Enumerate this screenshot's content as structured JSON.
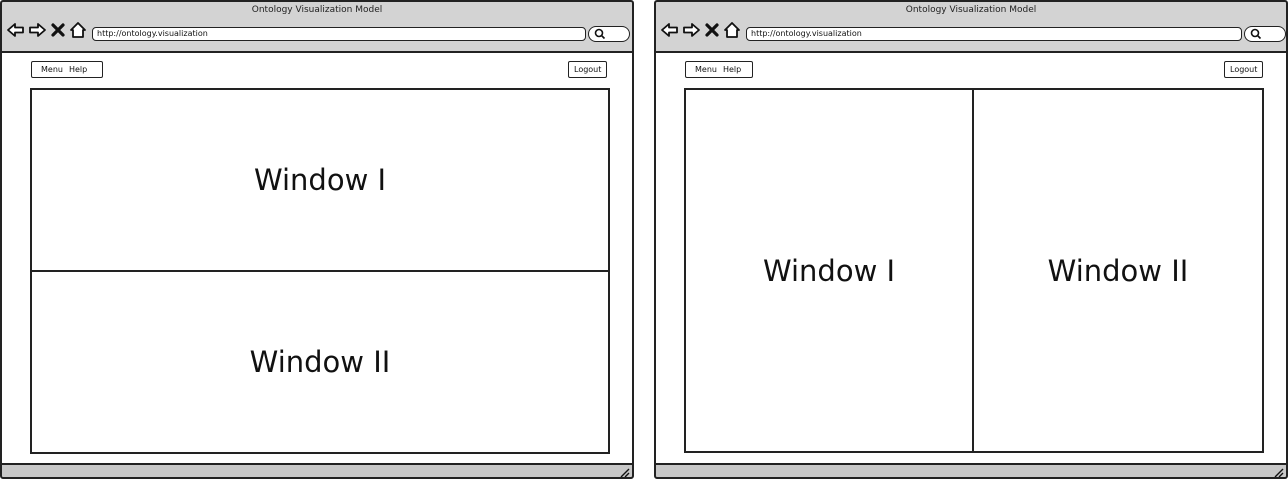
{
  "mockups": [
    {
      "layout": "stacked",
      "window_title": "Ontology Visualization Model",
      "url": "http://ontology.visualization",
      "menu": [
        "Menu",
        "Help"
      ],
      "logout_label": "Logout",
      "panels": [
        "Window I",
        "Window II"
      ]
    },
    {
      "layout": "side-by-side",
      "window_title": "Ontology Visualization Model",
      "url": "http://ontology.visualization",
      "menu": [
        "Menu",
        "Help"
      ],
      "logout_label": "Logout",
      "panels": [
        "Window I",
        "Window II"
      ]
    }
  ],
  "icons": {
    "back": "arrow-left-icon",
    "forward": "arrow-right-icon",
    "stop": "close-icon",
    "home": "home-icon",
    "search": "search-icon",
    "resize": "resize-grip-icon"
  }
}
